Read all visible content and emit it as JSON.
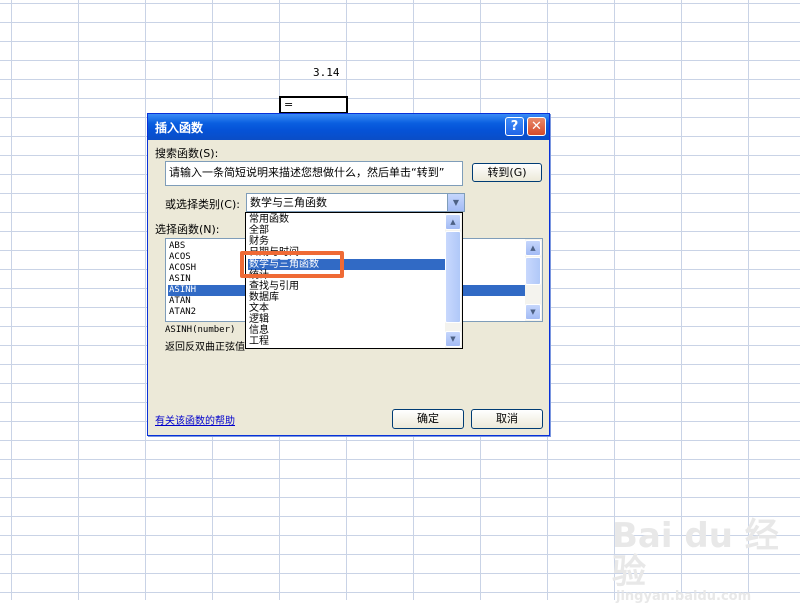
{
  "sheet": {
    "cell_value": "3.14",
    "active_cell_text": "="
  },
  "dialog": {
    "title": "插入函数",
    "help_btn": "?",
    "close_btn": "✕",
    "search_label": "搜索函数(S):",
    "search_placeholder": "请输入一条简短说明来描述您想做什么，然后单击“转到”",
    "goto_button": "转到(G)",
    "category_label": "或选择类别(C):",
    "category_value": "数学与三角函数",
    "function_label": "选择函数(N):",
    "functions": [
      {
        "name": "ABS",
        "selected": false
      },
      {
        "name": "ACOS",
        "selected": false
      },
      {
        "name": "ACOSH",
        "selected": false
      },
      {
        "name": "ASIN",
        "selected": false
      },
      {
        "name": "ASINH",
        "selected": true
      },
      {
        "name": "ATAN",
        "selected": false
      },
      {
        "name": "ATAN2",
        "selected": false
      }
    ],
    "signature": "ASINH(number)",
    "description": "返回反双曲正弦值",
    "help_link": "有关该函数的帮助",
    "ok_button": "确定",
    "cancel_button": "取消"
  },
  "dropdown": {
    "items": [
      {
        "label": "常用函数",
        "selected": false
      },
      {
        "label": "全部",
        "selected": false
      },
      {
        "label": "财务",
        "selected": false
      },
      {
        "label": "日期与时间",
        "selected": false
      },
      {
        "label": "数学与三角函数",
        "selected": true
      },
      {
        "label": "统计",
        "selected": false
      },
      {
        "label": "查找与引用",
        "selected": false
      },
      {
        "label": "数据库",
        "selected": false
      },
      {
        "label": "文本",
        "selected": false
      },
      {
        "label": "逻辑",
        "selected": false
      },
      {
        "label": "信息",
        "selected": false
      },
      {
        "label": "工程",
        "selected": false
      }
    ]
  },
  "watermark": {
    "main": "Bai du 经验",
    "sub": "jingyan.baidu.com"
  },
  "colors": {
    "highlight": "#ef6a35",
    "selection": "#316ac5",
    "titlebar": "#0a5fe0"
  },
  "icons": {
    "dropdown_arrow": "chevron-down-icon",
    "scroll_up": "chevron-up-icon",
    "scroll_down": "chevron-down-icon"
  }
}
